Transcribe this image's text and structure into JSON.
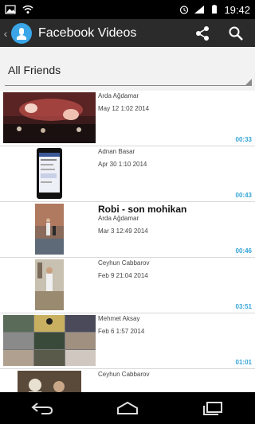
{
  "status_bar": {
    "time": "19:42"
  },
  "action_bar": {
    "title": "Facebook Videos",
    "share_icon": "share-icon",
    "search_icon": "search-icon"
  },
  "filter": {
    "selected": "All Friends"
  },
  "videos": [
    {
      "title": "",
      "name": "Arda Ağdamar",
      "date": "May 12 1:02 2014",
      "duration": "00:33"
    },
    {
      "title": "",
      "name": "Adnan Basar",
      "date": "Apr 30 1:10 2014",
      "duration": "00:43"
    },
    {
      "title": "Robi - son mohikan",
      "name": "Arda Ağdamar",
      "date": "Mar 3 12:49 2014",
      "duration": "00:46"
    },
    {
      "title": "",
      "name": "Ceyhun Cabbarov",
      "date": "Feb 9 21:04 2014",
      "duration": "03:51"
    },
    {
      "title": "",
      "name": "Mehmet Aksay",
      "date": "Feb 6 1:57 2014",
      "duration": "01:01"
    },
    {
      "title": "",
      "name": "Ceyhun Cabbarov",
      "date": "",
      "duration": ""
    }
  ],
  "colors": {
    "accent": "#33a4d8",
    "action_bar": "#2b2b2b",
    "app_icon": "#3aa6e8"
  }
}
